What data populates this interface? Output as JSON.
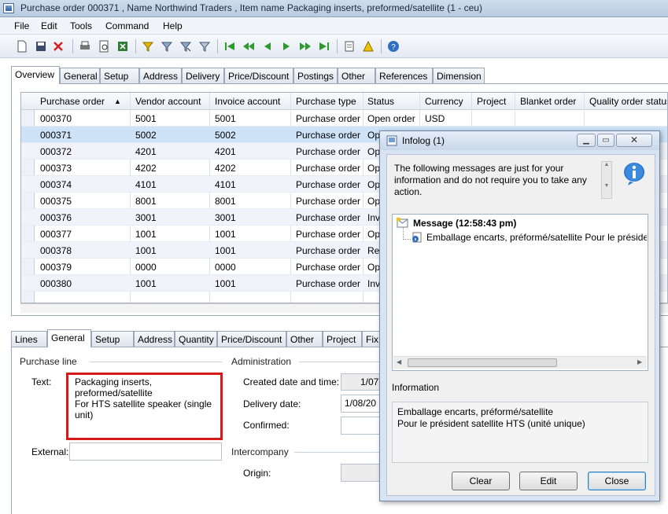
{
  "window": {
    "title": "Purchase order 000371 , Name Northwind Traders , Item name Packaging inserts, preformed/satellite (1 - ceu)"
  },
  "menu": [
    "File",
    "Edit",
    "Tools",
    "Command",
    "Help"
  ],
  "toolbar_icons": [
    "new-icon",
    "save-icon",
    "delete-icon",
    "print-icon",
    "print-preview-icon",
    "excel-icon",
    "filter-by-selection-icon",
    "filter-icon",
    "advanced-filter-icon",
    "remove-filter-icon",
    "first-record-icon",
    "previous-page-icon",
    "previous-record-icon",
    "next-record-icon",
    "next-page-icon",
    "last-record-icon",
    "document-handling-icon",
    "alert-icon",
    "help-icon"
  ],
  "top_tabs": [
    "Overview",
    "General",
    "Setup",
    "Address",
    "Delivery",
    "Price/Discount",
    "Postings",
    "Other",
    "References",
    "Dimension"
  ],
  "grid": {
    "columns": [
      "Purchase order",
      "Vendor account",
      "Invoice account",
      "Purchase type",
      "Status",
      "Currency",
      "Project",
      "Blanket order",
      "Quality order status"
    ],
    "rows": [
      [
        "000370",
        "5001",
        "5001",
        "Purchase order",
        "Open order",
        "USD"
      ],
      [
        "000371",
        "5002",
        "5002",
        "Purchase order",
        "Ope",
        ""
      ],
      [
        "000372",
        "4201",
        "4201",
        "Purchase order",
        "Ope",
        ""
      ],
      [
        "000373",
        "4202",
        "4202",
        "Purchase order",
        "Ope",
        ""
      ],
      [
        "000374",
        "4101",
        "4101",
        "Purchase order",
        "Ope",
        ""
      ],
      [
        "000375",
        "8001",
        "8001",
        "Purchase order",
        "Ope",
        ""
      ],
      [
        "000376",
        "3001",
        "3001",
        "Purchase order",
        "Inve",
        ""
      ],
      [
        "000377",
        "1001",
        "1001",
        "Purchase order",
        "Ope",
        ""
      ],
      [
        "000378",
        "1001",
        "1001",
        "Purchase order",
        "Rec",
        ""
      ],
      [
        "000379",
        "0000",
        "0000",
        "Purchase order",
        "Ope",
        ""
      ],
      [
        "000380",
        "1001",
        "1001",
        "Purchase order",
        "Inve",
        ""
      ]
    ]
  },
  "bottom_tabs": [
    "Lines",
    "General",
    "Setup",
    "Address",
    "Quantity",
    "Price/Discount",
    "Other",
    "Project",
    "Fix"
  ],
  "purchase_line": {
    "section": "Purchase line",
    "text_label": "Text:",
    "text_lines": [
      "Packaging inserts,",
      "preformed/satellite",
      "For HTS satellite speaker (single",
      "unit)"
    ],
    "external_label": "External:"
  },
  "administration": {
    "section": "Administration",
    "created_label": "Created date and time:",
    "created_value": "1/07",
    "delivery_label": "Delivery date:",
    "delivery_value": "1/08/20",
    "confirmed_label": "Confirmed:"
  },
  "intercompany": {
    "section": "Intercompany",
    "origin_label": "Origin:"
  },
  "infolog": {
    "title": "Infolog (1)",
    "intro_lines": [
      "The following messages are just for your",
      "information and do not require you to take any",
      "action."
    ],
    "tree_header": "Message (12:58:43 pm)",
    "tree_item": "Emballage encarts, préformé/satellite Pour le préside",
    "information_label": "Information",
    "info_lines": [
      "Emballage encarts, préformé/satellite",
      "Pour le président satellite HTS (unité unique)"
    ],
    "buttons": {
      "clear": "Clear",
      "edit": "Edit",
      "close": "Close"
    }
  }
}
